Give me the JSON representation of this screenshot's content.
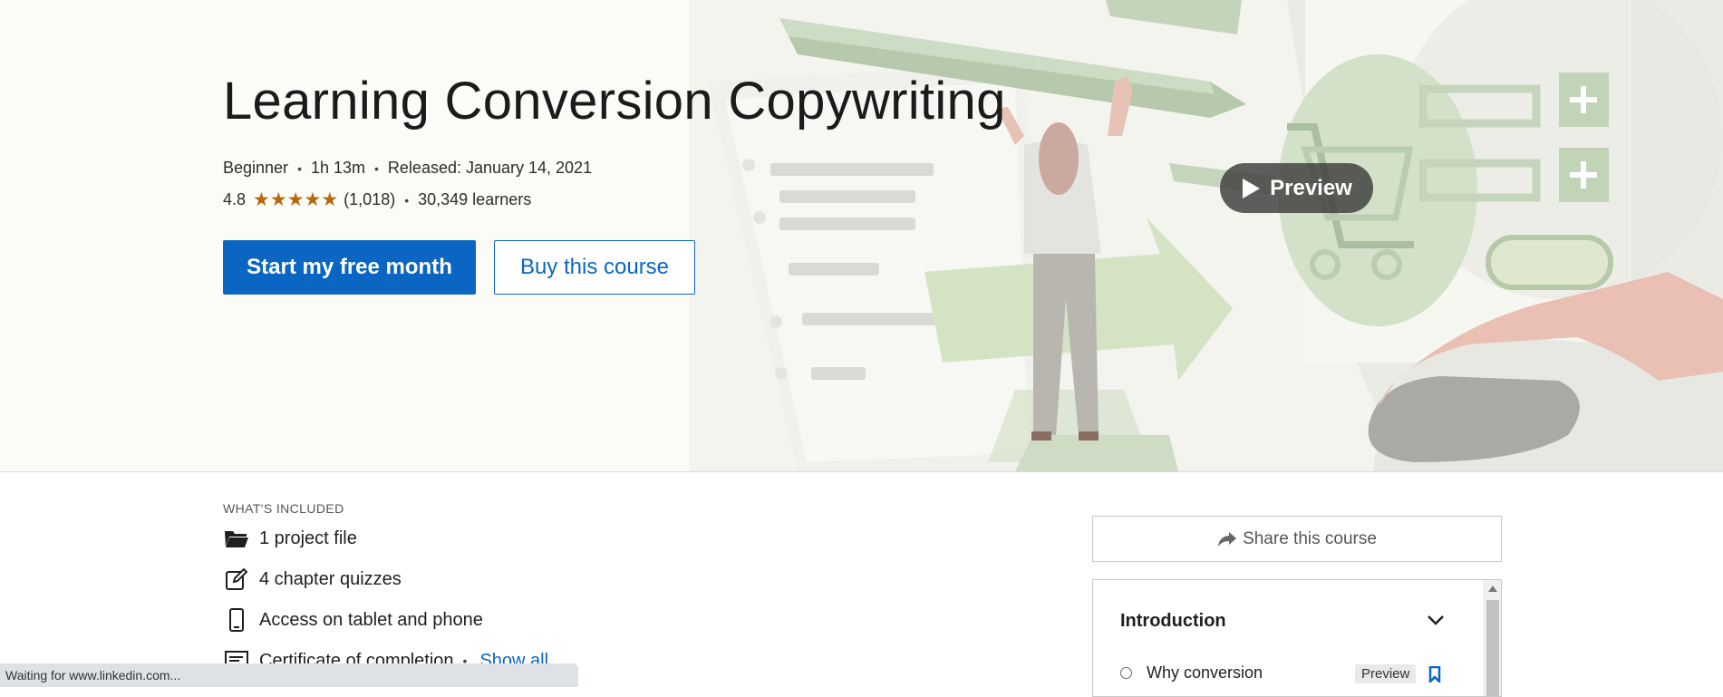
{
  "course": {
    "title": "Learning Conversion Copywriting",
    "level": "Beginner",
    "duration": "1h 13m",
    "released": "Released: January 14, 2021",
    "rating": "4.8",
    "stars": 5,
    "rating_count": "(1,018)",
    "learners": "30,349 learners"
  },
  "actions": {
    "start_free": "Start my free month",
    "buy": "Buy this course",
    "preview": "Preview",
    "share": "Share this course"
  },
  "included": {
    "label": "WHAT'S INCLUDED",
    "items": [
      {
        "text": "1 project file",
        "icon": "folder-icon"
      },
      {
        "text": "4 chapter quizzes",
        "icon": "edit-icon"
      },
      {
        "text": "Access on tablet and phone",
        "icon": "mobile-icon"
      },
      {
        "text": "Certificate of completion",
        "icon": "certificate-icon"
      }
    ],
    "show_all": "Show all"
  },
  "toc": {
    "section": "Introduction",
    "items": [
      {
        "title": "Why conversion",
        "badge": "Preview"
      }
    ]
  },
  "status": {
    "text": "Waiting for www.linkedin.com..."
  },
  "colors": {
    "primary": "#0a66c2",
    "star": "#b4690e"
  }
}
